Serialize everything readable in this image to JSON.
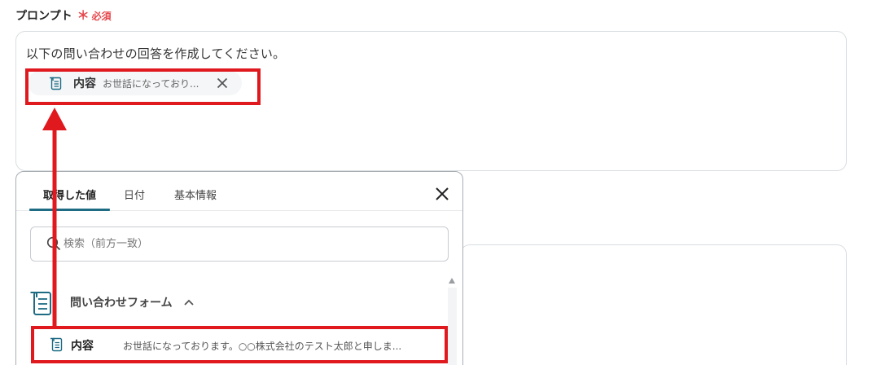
{
  "field": {
    "label": "プロンプト",
    "required_mark": "＊",
    "required_text": "必須"
  },
  "prompt": {
    "text": "以下の問い合わせの回答を作成してください。",
    "chip": {
      "icon": "form-icon",
      "name": "内容",
      "value": "お世話になっており..."
    }
  },
  "panel": {
    "tabs": [
      {
        "label": "取得した値",
        "active": true
      },
      {
        "label": "日付",
        "active": false
      },
      {
        "label": "基本情報",
        "active": false
      }
    ],
    "close_icon": "close-icon",
    "search": {
      "placeholder": "検索（前方一致）",
      "value": ""
    },
    "group": {
      "title": "問い合わせフォーム",
      "icon": "form-icon",
      "expanded": true
    },
    "items": [
      {
        "name": "内容",
        "value": "お世話になっております。○○株式会社のテスト太郎と申しま..."
      }
    ]
  },
  "annotation": {
    "highlight_color": "#e0191f"
  },
  "colors": {
    "accent": "#1e6b84",
    "required": "#e5484d"
  }
}
